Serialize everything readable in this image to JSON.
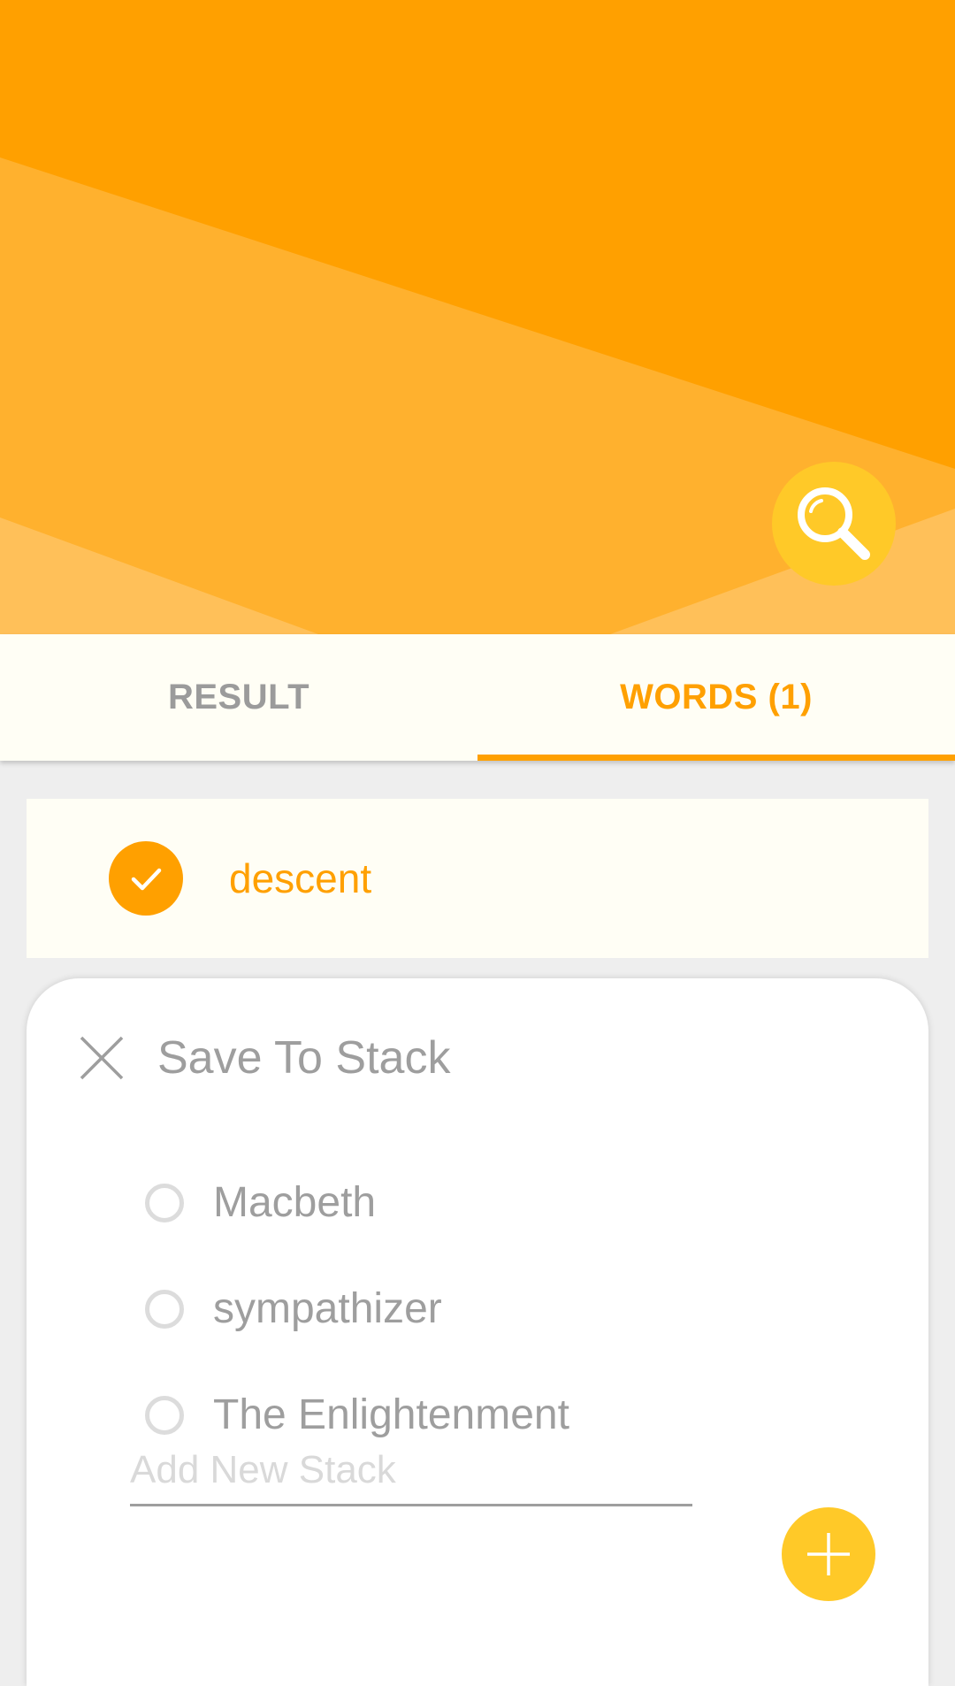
{
  "header": {
    "search_icon": "search-icon",
    "colors": {
      "orange_dark": "#ffa000",
      "orange_mid": "#ffb12e",
      "orange_light": "#ffc059",
      "fab_yellow": "#ffc928"
    }
  },
  "tabs": [
    {
      "label": "RESULT",
      "active": false
    },
    {
      "label": "WORDS (1)",
      "active": true
    }
  ],
  "word": {
    "text": "descent",
    "checked": true,
    "icon": "check-icon"
  },
  "dialog": {
    "title": "Save To Stack",
    "close_icon": "close-icon",
    "stacks": [
      {
        "label": "Macbeth",
        "selected": false
      },
      {
        "label": "sympathizer",
        "selected": false
      },
      {
        "label": "The Enlightenment",
        "selected": false
      }
    ],
    "new_stack": {
      "placeholder": "Add New Stack",
      "value": ""
    },
    "add_icon": "plus-icon"
  }
}
